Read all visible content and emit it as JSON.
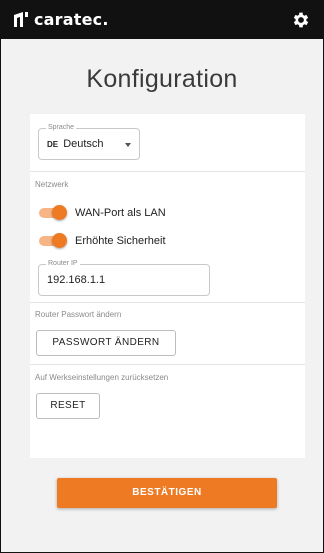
{
  "app": {
    "brand": "caratec.",
    "settings_icon": "gear-icon",
    "logo_icon": "caratec-logo-mark"
  },
  "page": {
    "title": "Konfiguration"
  },
  "language": {
    "label": "Sprache",
    "code": "DE",
    "value": "Deutsch"
  },
  "network": {
    "label": "Netzwerk",
    "toggles": [
      {
        "label": "WAN-Port als LAN",
        "on": true
      },
      {
        "label": "Erhöhte Sicherheit",
        "on": true
      }
    ],
    "router_ip": {
      "label": "Router IP",
      "value": "192.168.1.1"
    }
  },
  "password": {
    "label": "Router Passwort ändern",
    "button": "PASSWORT ÄNDERN"
  },
  "reset": {
    "label": "Auf Werkseinstellungen zurücksetzen",
    "button": "RESET"
  },
  "confirm": {
    "button": "BESTÄTIGEN"
  },
  "colors": {
    "accent": "#ee7a24",
    "appbar": "#111111",
    "background": "#f2f2f2"
  }
}
